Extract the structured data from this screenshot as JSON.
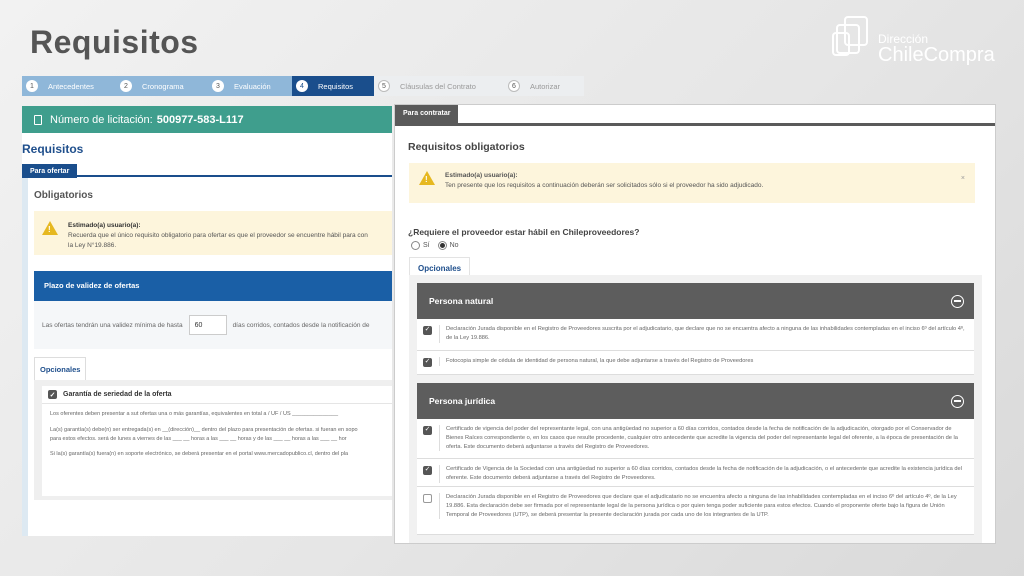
{
  "slide": {
    "title": "Requisitos"
  },
  "logo": {
    "line1": "Dirección",
    "line2": "ChileCompra"
  },
  "stepper": [
    {
      "num": "1",
      "label": "Antecedentes",
      "state": "done"
    },
    {
      "num": "2",
      "label": "Cronograma",
      "state": "done"
    },
    {
      "num": "3",
      "label": "Evaluación",
      "state": "done"
    },
    {
      "num": "4",
      "label": "Requisitos",
      "state": "active"
    },
    {
      "num": "5",
      "label": "Cláusulas del Contrato",
      "state": "pending"
    },
    {
      "num": "6",
      "label": "Autorizar",
      "state": "pending"
    }
  ],
  "left": {
    "licitacion_label": "Número de licitación:",
    "licitacion_value": "500977-583-L117",
    "heading": "Requisitos",
    "tab": "Para ofertar",
    "section": "Obligatorios",
    "warn_title": "Estimado(a) usuario(a):",
    "warn_text1": "Recuerda que el único requisito obligatorio para ofertar es que el proveedor se encuentre hábil para con",
    "warn_text2": "la Ley N°19.886.",
    "plazo_header": "Plazo de validez de ofertas",
    "plazo_text_before": "Las ofertas tendrán una validez mínima de hasta",
    "plazo_value": "60",
    "plazo_text_after": "días corridos, contados desde la notificación de",
    "opcionales_tab": "Opcionales",
    "garantia_title": "Garantía de seriedad de la oferta",
    "garantia_lines": [
      "Los oferentes deben presentar a sut ofertas una o más garantías, equivalentes en total a  / UF / US _______________",
      "La(s) garantía(s) debe(n) ser entregada(s) en __(dirección)__ dentro del plazo para presentación de ofertas. si fueran en sopo",
      "para estos efectos. será de lunes a viernes de las ___ __ horas a las ___ __ horas y de las ___ __ horas a las ___ __ hor",
      "Si la(s) garantía(s) fuera(n) en soporte electrónico, se deberá presentar en el portal www.mercadopublico.cl, dentro del pla"
    ]
  },
  "right": {
    "tab": "Para contratar",
    "title": "Requisitos obligatorios",
    "warn_title": "Estimado(a) usuario(a):",
    "warn_text": "Ten presente que los requisitos a continuación deberán ser solicitados sólo si el proveedor ha sido adjudicado.",
    "warn_close": "×",
    "question": "¿Requiere el proveedor estar hábil en Chileproveedores?",
    "radio_yes": "Sí",
    "radio_no": "No",
    "radio_selected": "No",
    "opcionales_tab": "Opcionales",
    "persona_natural": {
      "title": "Persona natural",
      "items": [
        {
          "checked": true,
          "text": "Declaración Jurada disponible en el Registro de Proveedores suscrita por el adjudicatario, que declare que no se encuentra afecto a ninguna de las inhabilidades contempladas en el inciso 6º del artículo 4º, de la Ley 19.886."
        },
        {
          "checked": true,
          "text": "Fotocopia simple de cédula de identidad de persona natural, la que debe adjuntarse a través del Registro de Proveedores"
        }
      ]
    },
    "persona_juridica": {
      "title": "Persona jurídica",
      "items": [
        {
          "checked": true,
          "text": "Certificado de vigencia del poder del representante legal, con una antigüedad no superior a 60 días corridos, contados desde la fecha de notificación de la adjudicación, otorgado por el Conservador de Bienes Raíces correspondiente o, en los casos que resulte procedente, cualquier otro antecedente que acredite la vigencia del poder del representante legal del oferente, a la época de presentación de la oferta. Este documento deberá adjuntarse a través del Registro de Proveedores."
        },
        {
          "checked": true,
          "text": "Certificado de Vigencia de la Sociedad con una antigüedad no superior a 60 días corridos, contados desde la fecha de notificación de la adjudicación, o el antecedente que acredite la existencia jurídica del oferente. Este documento deberá adjuntarse a través del Registro de Proveedores."
        },
        {
          "checked": false,
          "text": "Declaración Jurada disponible en el Registro de Proveedores que declare que el adjudicatario no se encuentra afecto a ninguna de las inhabilidades contempladas en el inciso 6º del artículo 4º, de la Ley 19.886. Esta declaración debe ser firmada por el representante legal de la persona jurídica o por quien tenga poder suficiente para estos efectos. Cuando el proponente oferte bajo la figura de Unión Temporal de Proveedores (UTP), se deberá presentar la presente declaración jurada por cada uno de los integrantes de la UTP."
        }
      ]
    }
  }
}
